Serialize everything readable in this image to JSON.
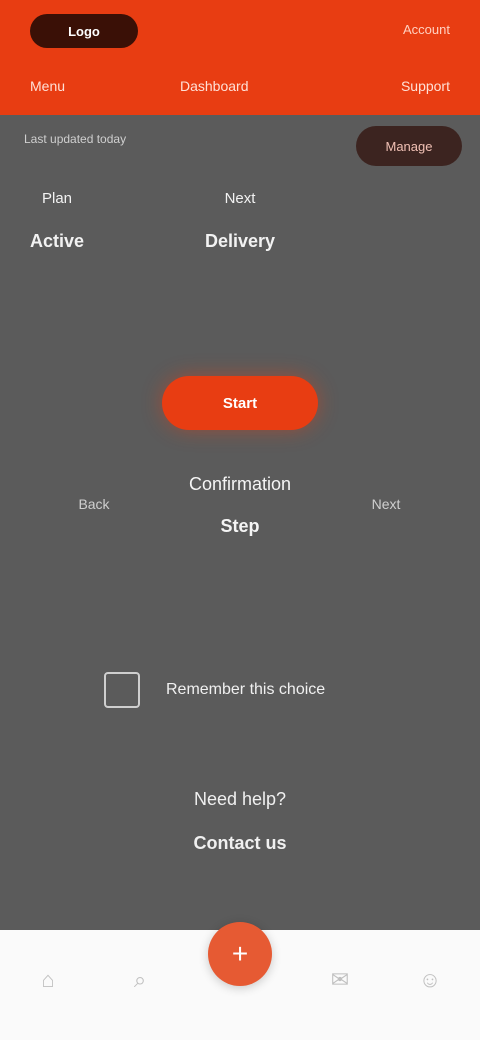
{
  "header": {
    "brand": "Logo",
    "top_right": "Account",
    "nav": {
      "left": "Menu",
      "center": "Dashboard",
      "right": "Support"
    }
  },
  "topline": "Last updated today",
  "action_button": "Manage",
  "stats": [
    {
      "title": "Plan",
      "value": "Active"
    },
    {
      "title": "Next",
      "value": "Delivery"
    }
  ],
  "cta_label": "Start",
  "row": {
    "left": "Back",
    "center": "Confirmation",
    "center_sub": "Step",
    "right": "Next"
  },
  "checkbox_label": "Remember this choice",
  "link": {
    "line1": "Need help?",
    "line2": "Contact us"
  },
  "tabs": {
    "icons": [
      "home-icon",
      "search-icon",
      "plus-icon",
      "chat-icon",
      "profile-icon"
    ],
    "colors": {
      "accent": "#e83d12",
      "fab": "#e65a33",
      "background": "#5b5b5b"
    }
  }
}
